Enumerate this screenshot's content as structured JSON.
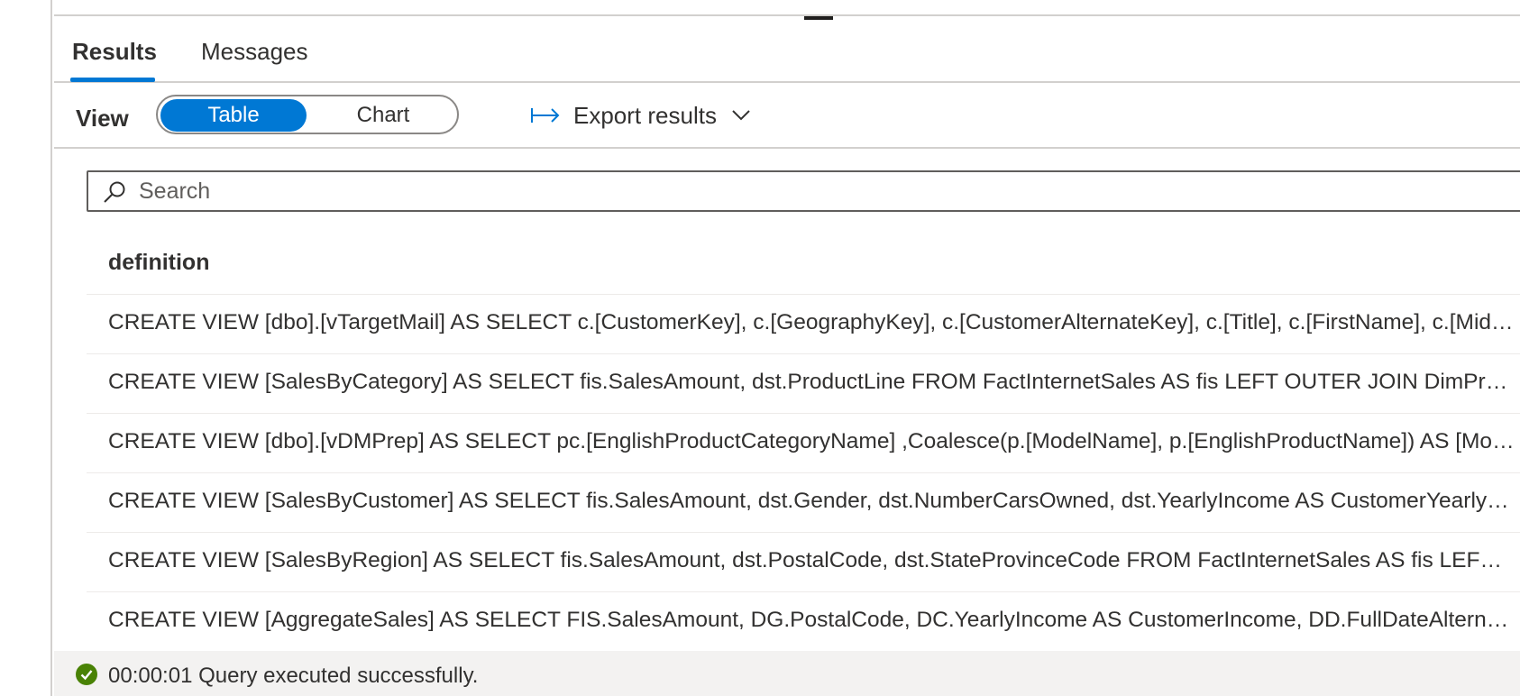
{
  "tabs": {
    "results": "Results",
    "messages": "Messages"
  },
  "toolbar": {
    "view_label": "View",
    "view_options": [
      "Table",
      "Chart"
    ],
    "selected_view": "Table",
    "export_label": "Export results"
  },
  "search": {
    "placeholder": "Search",
    "value": ""
  },
  "grid": {
    "columns": [
      "definition"
    ],
    "rows": [
      "CREATE VIEW [dbo].[vTargetMail] AS SELECT c.[CustomerKey], c.[GeographyKey], c.[CustomerAlternateKey], c.[Title], c.[FirstName], c.[MiddleName]",
      "CREATE VIEW [SalesByCategory] AS SELECT fis.SalesAmount, dst.ProductLine FROM FactInternetSales AS fis LEFT OUTER JOIN DimProduct",
      "CREATE VIEW [dbo].[vDMPrep] AS SELECT pc.[EnglishProductCategoryName] ,Coalesce(p.[ModelName], p.[EnglishProductName]) AS [Model]",
      "CREATE VIEW [SalesByCustomer] AS SELECT fis.SalesAmount, dst.Gender, dst.NumberCarsOwned, dst.YearlyIncome AS CustomerYearlyIncome",
      "CREATE VIEW [SalesByRegion] AS SELECT fis.SalesAmount, dst.PostalCode, dst.StateProvinceCode FROM FactInternetSales AS fis LEFT OUTER JOIN",
      "CREATE VIEW [AggregateSales] AS SELECT FIS.SalesAmount, DG.PostalCode, DC.YearlyIncome AS CustomerIncome, DD.FullDateAlternateKey"
    ]
  },
  "status": {
    "text": "00:00:01 Query executed successfully.",
    "icon": "success-check-icon",
    "color": "#498205"
  },
  "colors": {
    "accent": "#0078d4",
    "success": "#498205"
  }
}
